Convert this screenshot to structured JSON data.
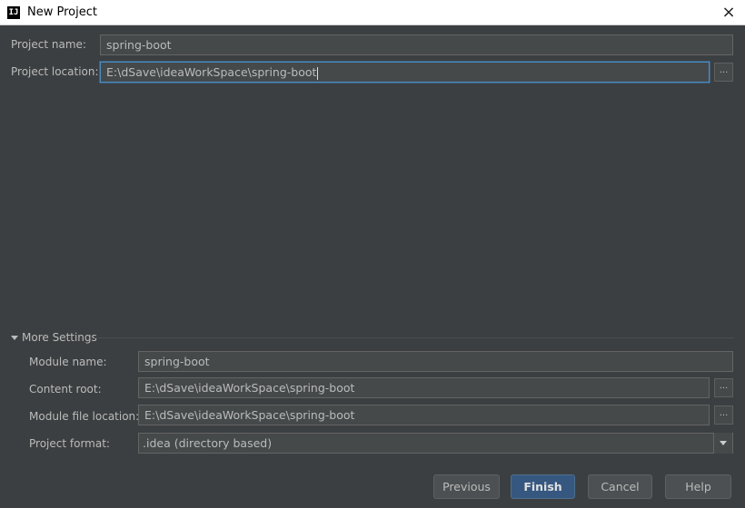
{
  "window": {
    "title": "New Project",
    "icon_text": "IJ",
    "close_glyph": "×"
  },
  "project": {
    "name_label": "Project name:",
    "name_value": "spring-boot",
    "location_label": "Project location:",
    "location_value": "E:\\dSave\\ideaWorkSpace\\spring-boot",
    "browse_label": "..."
  },
  "more_settings": {
    "header": "More Settings",
    "expanded": true,
    "module_name_label": "Module name:",
    "module_name_value": "spring-boot",
    "content_root_label": "Content root:",
    "content_root_value": "E:\\dSave\\ideaWorkSpace\\spring-boot",
    "module_file_label": "Module file location:",
    "module_file_value": "E:\\dSave\\ideaWorkSpace\\spring-boot",
    "project_format_label": "Project format:",
    "project_format_value": ".idea (directory based)",
    "browse_label": "..."
  },
  "buttons": {
    "previous": "Previous",
    "finish": "Finish",
    "cancel": "Cancel",
    "help": "Help"
  },
  "colors": {
    "background": "#3c3f41",
    "field_bg": "#45494a",
    "focus_border": "#4b8dc1",
    "primary_button": "#365880"
  }
}
